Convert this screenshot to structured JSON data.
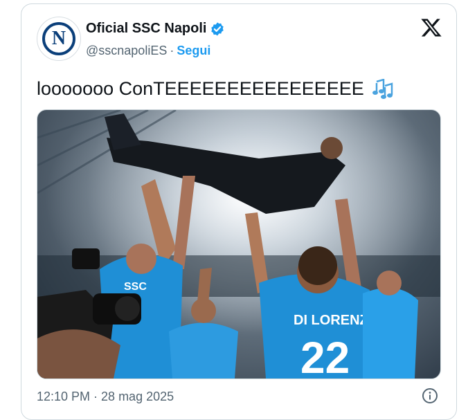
{
  "account": {
    "name": "Oficial SSC Napoli",
    "handle": "@sscnapoliES",
    "separator": "·",
    "follow_label": "Segui",
    "avatar_letter": "N"
  },
  "tweet": {
    "text": "looooooo ConTEEEEEEEEEEEEEEEE",
    "emoji": "music-notes-icon",
    "jersey_text": "DI LORENZO",
    "jersey_number": "22",
    "crest_text": "SSC",
    "timestamp": "12:10 PM · 28 mag 2025"
  },
  "colors": {
    "accent": "#1d9bf0",
    "text": "#0f1419",
    "muted": "#536471",
    "napoli_blue": "#1f8fd6"
  }
}
